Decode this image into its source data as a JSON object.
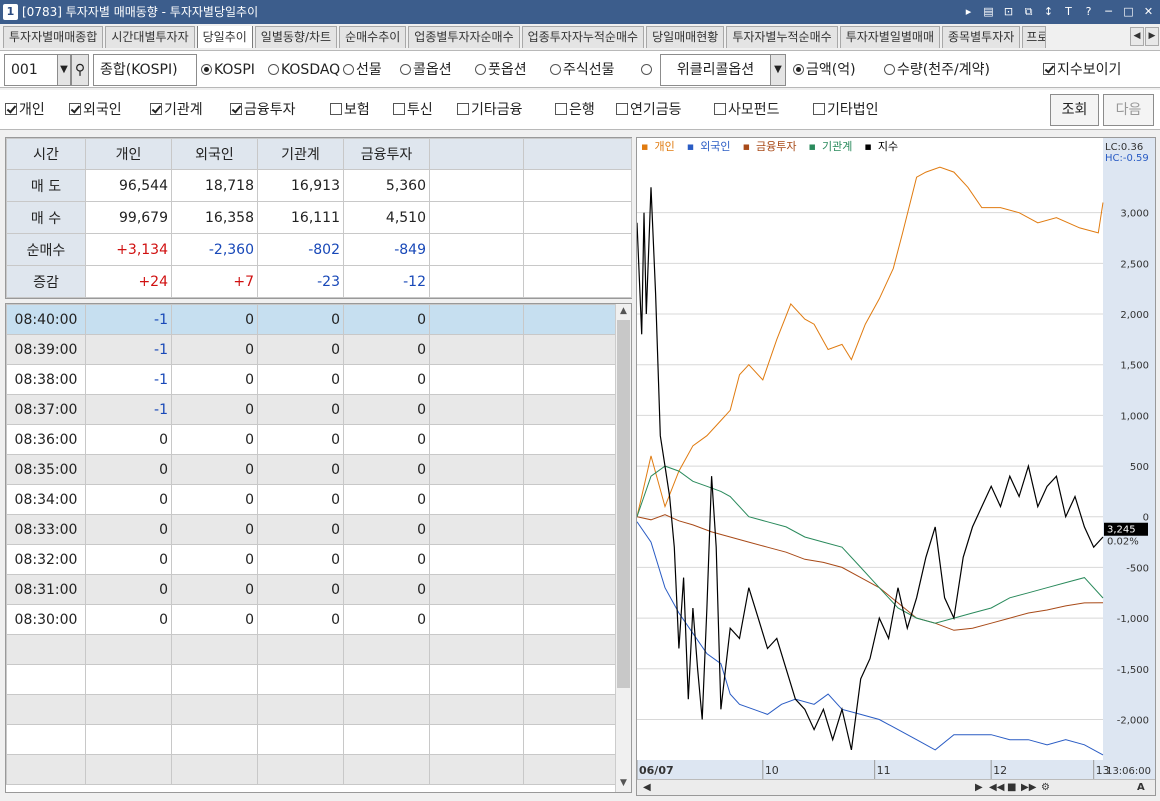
{
  "window": {
    "number": "1",
    "title": "[0783] 투자자별 매매동향 - 투자자별당일추이",
    "buttons": [
      "▸",
      "▤",
      "⊡",
      "⧉",
      "↕",
      "T",
      "?",
      "─",
      "□",
      "✕"
    ]
  },
  "tabs": [
    {
      "label": "투자자별매매종합"
    },
    {
      "label": "시간대별투자자"
    },
    {
      "label": "당일추이",
      "active": true
    },
    {
      "label": "일별동향/차트"
    },
    {
      "label": "순매수추이"
    },
    {
      "label": "업종별투자자순매수"
    },
    {
      "label": "업종투자자누적순매수"
    },
    {
      "label": "당일매매현황"
    },
    {
      "label": "투자자별누적순매수"
    },
    {
      "label": "투자자별일별매매"
    },
    {
      "label": "종목별투자자"
    },
    {
      "label": "프로"
    }
  ],
  "tab_nav": [
    "◀",
    "▶"
  ],
  "controls": {
    "code": "001",
    "code_dropdown": "▼",
    "search_icon": "⚲",
    "market_name": "종합(KOSPI)",
    "markets": [
      {
        "label": "KOSPI",
        "selected": true
      },
      {
        "label": "KOSDAQ",
        "selected": false
      },
      {
        "label": "선물",
        "selected": false
      },
      {
        "label": "콜옵션",
        "selected": false
      },
      {
        "label": "풋옵션",
        "selected": false
      },
      {
        "label": "주식선물",
        "selected": false
      },
      {
        "label": "",
        "selected": false
      }
    ],
    "weekly_option": "위클리콜옵션",
    "weekly_dropdown": "▼",
    "units": [
      {
        "label": "금액(억)",
        "selected": true
      },
      {
        "label": "수량(천주/계약)",
        "selected": false
      }
    ],
    "show_index": {
      "label": "지수보이기",
      "checked": true
    }
  },
  "investors": [
    {
      "label": "개인",
      "checked": true
    },
    {
      "label": "외국인",
      "checked": true
    },
    {
      "label": "기관계",
      "checked": true
    },
    {
      "label": "금융투자",
      "checked": true
    },
    {
      "label": "보험",
      "checked": false
    },
    {
      "label": "투신",
      "checked": false
    },
    {
      "label": "기타금융",
      "checked": false
    },
    {
      "label": "은행",
      "checked": false
    },
    {
      "label": "연기금등",
      "checked": false
    },
    {
      "label": "사모펀드",
      "checked": false
    },
    {
      "label": "기타법인",
      "checked": false
    }
  ],
  "buttons": {
    "query": "조회",
    "next": "다음"
  },
  "summary": {
    "headers": [
      "시간",
      "개인",
      "외국인",
      "기관계",
      "금융투자",
      "",
      ""
    ],
    "rows": [
      {
        "label": "매 도",
        "values": [
          "96,544",
          "18,718",
          "16,913",
          "5,360",
          "",
          ""
        ],
        "colors": [
          "",
          "",
          "",
          "",
          "",
          ""
        ]
      },
      {
        "label": "매 수",
        "values": [
          "99,679",
          "16,358",
          "16,111",
          "4,510",
          "",
          ""
        ],
        "colors": [
          "",
          "",
          "",
          "",
          "",
          ""
        ]
      },
      {
        "label": "순매수",
        "values": [
          "+3,134",
          "-2,360",
          "-802",
          "-849",
          "",
          ""
        ],
        "colors": [
          "red",
          "blue",
          "blue",
          "blue",
          "",
          ""
        ]
      },
      {
        "label": "증감",
        "values": [
          "+24",
          "+7",
          "-23",
          "-12",
          "",
          ""
        ],
        "colors": [
          "red",
          "red",
          "blue",
          "blue",
          "",
          ""
        ]
      }
    ]
  },
  "timeseries": [
    {
      "time": "08:40:00",
      "values": [
        "-1",
        "0",
        "0",
        "0",
        "",
        ""
      ],
      "colors": [
        "blue",
        "",
        "",
        "",
        "",
        ""
      ]
    },
    {
      "time": "08:39:00",
      "values": [
        "-1",
        "0",
        "0",
        "0",
        "",
        ""
      ],
      "colors": [
        "blue",
        "",
        "",
        "",
        "",
        ""
      ]
    },
    {
      "time": "08:38:00",
      "values": [
        "-1",
        "0",
        "0",
        "0",
        "",
        ""
      ],
      "colors": [
        "blue",
        "",
        "",
        "",
        "",
        ""
      ]
    },
    {
      "time": "08:37:00",
      "values": [
        "-1",
        "0",
        "0",
        "0",
        "",
        ""
      ],
      "colors": [
        "blue",
        "",
        "",
        "",
        "",
        ""
      ]
    },
    {
      "time": "08:36:00",
      "values": [
        "0",
        "0",
        "0",
        "0",
        "",
        ""
      ],
      "colors": [
        "",
        "",
        "",
        "",
        "",
        ""
      ]
    },
    {
      "time": "08:35:00",
      "values": [
        "0",
        "0",
        "0",
        "0",
        "",
        ""
      ],
      "colors": [
        "",
        "",
        "",
        "",
        "",
        ""
      ]
    },
    {
      "time": "08:34:00",
      "values": [
        "0",
        "0",
        "0",
        "0",
        "",
        ""
      ],
      "colors": [
        "",
        "",
        "",
        "",
        "",
        ""
      ]
    },
    {
      "time": "08:33:00",
      "values": [
        "0",
        "0",
        "0",
        "0",
        "",
        ""
      ],
      "colors": [
        "",
        "",
        "",
        "",
        "",
        ""
      ]
    },
    {
      "time": "08:32:00",
      "values": [
        "0",
        "0",
        "0",
        "0",
        "",
        ""
      ],
      "colors": [
        "",
        "",
        "",
        "",
        "",
        ""
      ]
    },
    {
      "time": "08:31:00",
      "values": [
        "0",
        "0",
        "0",
        "0",
        "",
        ""
      ],
      "colors": [
        "",
        "",
        "",
        "",
        "",
        ""
      ]
    },
    {
      "time": "08:30:00",
      "values": [
        "0",
        "0",
        "0",
        "0",
        "",
        ""
      ],
      "colors": [
        "",
        "",
        "",
        "",
        "",
        ""
      ]
    }
  ],
  "scroll_arrows": {
    "up": "▲",
    "down": "▼"
  },
  "chart_data": {
    "type": "line",
    "title": "",
    "xlabel": "",
    "ylabel": "",
    "x_ticks": [
      "06/07",
      "10",
      "11",
      "12",
      "13"
    ],
    "y_ticks": [
      3000,
      2500,
      2000,
      1500,
      1000,
      500,
      0,
      -500,
      -1000,
      -1500,
      -2000
    ],
    "ylim": [
      -2400,
      3500
    ],
    "grid": true,
    "legend": "top-left",
    "legend_labels": [
      "개인",
      "외국인",
      "금융투자",
      "기관계",
      "지수"
    ],
    "top_right_labels": [
      "LC:0.36",
      "HC:-0.59"
    ],
    "last_value_label": "3,245",
    "last_pct_label": "0.02%",
    "time_label": "13:06:00",
    "colors": {
      "individual": "#e07b10",
      "foreign": "#2a5cc4",
      "financial": "#a84a18",
      "institution": "#2a8a5c",
      "index": "#000000"
    },
    "series": [
      {
        "name": "개인",
        "color": "#e07b10",
        "points": [
          [
            0.0,
            0
          ],
          [
            0.03,
            600
          ],
          [
            0.06,
            100
          ],
          [
            0.09,
            450
          ],
          [
            0.12,
            700
          ],
          [
            0.15,
            800
          ],
          [
            0.18,
            950
          ],
          [
            0.2,
            1050
          ],
          [
            0.22,
            1400
          ],
          [
            0.24,
            1500
          ],
          [
            0.27,
            1350
          ],
          [
            0.3,
            1750
          ],
          [
            0.33,
            2100
          ],
          [
            0.36,
            1950
          ],
          [
            0.38,
            1900
          ],
          [
            0.41,
            1650
          ],
          [
            0.44,
            1700
          ],
          [
            0.46,
            1550
          ],
          [
            0.49,
            1900
          ],
          [
            0.52,
            2150
          ],
          [
            0.55,
            2450
          ],
          [
            0.57,
            2800
          ],
          [
            0.6,
            3350
          ],
          [
            0.62,
            3400
          ],
          [
            0.65,
            3450
          ],
          [
            0.68,
            3400
          ],
          [
            0.71,
            3250
          ],
          [
            0.74,
            3050
          ],
          [
            0.78,
            3050
          ],
          [
            0.82,
            3000
          ],
          [
            0.86,
            2900
          ],
          [
            0.9,
            2950
          ],
          [
            0.95,
            2850
          ],
          [
            0.99,
            2800
          ],
          [
            1.0,
            3100
          ]
        ]
      },
      {
        "name": "외국인",
        "color": "#2a5cc4",
        "points": [
          [
            0.0,
            -50
          ],
          [
            0.03,
            -250
          ],
          [
            0.06,
            -700
          ],
          [
            0.09,
            -950
          ],
          [
            0.12,
            -1150
          ],
          [
            0.15,
            -1350
          ],
          [
            0.18,
            -1450
          ],
          [
            0.2,
            -1750
          ],
          [
            0.22,
            -1850
          ],
          [
            0.25,
            -1900
          ],
          [
            0.28,
            -1950
          ],
          [
            0.31,
            -1850
          ],
          [
            0.34,
            -1800
          ],
          [
            0.38,
            -1850
          ],
          [
            0.41,
            -1750
          ],
          [
            0.44,
            -1900
          ],
          [
            0.48,
            -1950
          ],
          [
            0.52,
            -2000
          ],
          [
            0.56,
            -2100
          ],
          [
            0.6,
            -2200
          ],
          [
            0.64,
            -2300
          ],
          [
            0.68,
            -2150
          ],
          [
            0.72,
            -2150
          ],
          [
            0.76,
            -2150
          ],
          [
            0.8,
            -2200
          ],
          [
            0.84,
            -2200
          ],
          [
            0.88,
            -2250
          ],
          [
            0.92,
            -2200
          ],
          [
            0.96,
            -2250
          ],
          [
            1.0,
            -2350
          ]
        ]
      },
      {
        "name": "금융투자",
        "color": "#a84a18",
        "points": [
          [
            0.0,
            0
          ],
          [
            0.03,
            -30
          ],
          [
            0.06,
            20
          ],
          [
            0.09,
            -40
          ],
          [
            0.12,
            -80
          ],
          [
            0.16,
            -150
          ],
          [
            0.2,
            -200
          ],
          [
            0.24,
            -250
          ],
          [
            0.28,
            -300
          ],
          [
            0.32,
            -350
          ],
          [
            0.36,
            -420
          ],
          [
            0.4,
            -450
          ],
          [
            0.44,
            -500
          ],
          [
            0.48,
            -600
          ],
          [
            0.52,
            -700
          ],
          [
            0.56,
            -850
          ],
          [
            0.6,
            -1000
          ],
          [
            0.64,
            -1050
          ],
          [
            0.68,
            -1120
          ],
          [
            0.72,
            -1100
          ],
          [
            0.76,
            -1050
          ],
          [
            0.8,
            -1000
          ],
          [
            0.84,
            -950
          ],
          [
            0.88,
            -920
          ],
          [
            0.92,
            -880
          ],
          [
            0.96,
            -850
          ],
          [
            1.0,
            -849
          ]
        ]
      },
      {
        "name": "기관계",
        "color": "#2a8a5c",
        "points": [
          [
            0.0,
            0
          ],
          [
            0.03,
            400
          ],
          [
            0.06,
            500
          ],
          [
            0.09,
            450
          ],
          [
            0.12,
            350
          ],
          [
            0.15,
            300
          ],
          [
            0.18,
            250
          ],
          [
            0.2,
            200
          ],
          [
            0.24,
            0
          ],
          [
            0.28,
            -50
          ],
          [
            0.32,
            -100
          ],
          [
            0.36,
            -200
          ],
          [
            0.4,
            -250
          ],
          [
            0.44,
            -300
          ],
          [
            0.48,
            -500
          ],
          [
            0.52,
            -700
          ],
          [
            0.56,
            -900
          ],
          [
            0.6,
            -1000
          ],
          [
            0.64,
            -1050
          ],
          [
            0.68,
            -1000
          ],
          [
            0.72,
            -950
          ],
          [
            0.76,
            -900
          ],
          [
            0.8,
            -800
          ],
          [
            0.84,
            -750
          ],
          [
            0.88,
            -700
          ],
          [
            0.92,
            -650
          ],
          [
            0.96,
            -600
          ],
          [
            1.0,
            -802
          ]
        ]
      },
      {
        "name": "지수",
        "color": "#000000",
        "points": [
          [
            0.0,
            2900
          ],
          [
            0.01,
            1800
          ],
          [
            0.015,
            3000
          ],
          [
            0.02,
            2000
          ],
          [
            0.03,
            3250
          ],
          [
            0.04,
            2200
          ],
          [
            0.05,
            800
          ],
          [
            0.06,
            500
          ],
          [
            0.07,
            200
          ],
          [
            0.08,
            -300
          ],
          [
            0.09,
            -1300
          ],
          [
            0.1,
            -600
          ],
          [
            0.11,
            -1800
          ],
          [
            0.12,
            -900
          ],
          [
            0.13,
            -1500
          ],
          [
            0.14,
            -2000
          ],
          [
            0.15,
            -900
          ],
          [
            0.16,
            400
          ],
          [
            0.17,
            -300
          ],
          [
            0.18,
            -1900
          ],
          [
            0.2,
            -1100
          ],
          [
            0.22,
            -1200
          ],
          [
            0.24,
            -700
          ],
          [
            0.26,
            -1000
          ],
          [
            0.28,
            -1300
          ],
          [
            0.3,
            -1200
          ],
          [
            0.32,
            -1500
          ],
          [
            0.34,
            -1800
          ],
          [
            0.36,
            -1900
          ],
          [
            0.38,
            -2100
          ],
          [
            0.4,
            -1900
          ],
          [
            0.42,
            -2200
          ],
          [
            0.44,
            -1900
          ],
          [
            0.46,
            -2300
          ],
          [
            0.48,
            -1600
          ],
          [
            0.5,
            -1400
          ],
          [
            0.52,
            -1000
          ],
          [
            0.54,
            -1200
          ],
          [
            0.56,
            -700
          ],
          [
            0.58,
            -1100
          ],
          [
            0.6,
            -800
          ],
          [
            0.62,
            -400
          ],
          [
            0.64,
            -100
          ],
          [
            0.66,
            -800
          ],
          [
            0.68,
            -1000
          ],
          [
            0.7,
            -400
          ],
          [
            0.72,
            -100
          ],
          [
            0.74,
            100
          ],
          [
            0.76,
            300
          ],
          [
            0.78,
            100
          ],
          [
            0.8,
            400
          ],
          [
            0.82,
            200
          ],
          [
            0.84,
            500
          ],
          [
            0.86,
            100
          ],
          [
            0.88,
            300
          ],
          [
            0.9,
            400
          ],
          [
            0.92,
            0
          ],
          [
            0.94,
            200
          ],
          [
            0.96,
            -100
          ],
          [
            0.98,
            -300
          ],
          [
            1.0,
            -200
          ]
        ]
      }
    ]
  }
}
